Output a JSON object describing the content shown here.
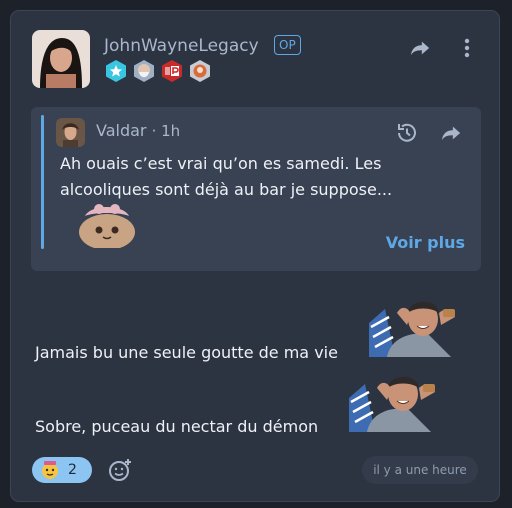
{
  "post": {
    "author": "JohnWayneLegacy",
    "op_label": "OP",
    "badges": [
      "star-badge",
      "bearded-man-badge",
      "red-p-badge",
      "mascot-badge"
    ],
    "actions": [
      "share-icon",
      "more-options-icon"
    ]
  },
  "quote": {
    "author": "Valdar",
    "time": "· 1h",
    "text": "Ah ouais c’est vrai qu’on es samedi. Les alcooliques sont déjà au bar je suppose...",
    "see_more": "Voir plus",
    "actions": [
      "history-icon",
      "share-icon"
    ]
  },
  "body": {
    "line1": "Jamais bu une seule goutte de ma vie",
    "line2": "Sobre, puceau du nectar du démon"
  },
  "footer": {
    "reaction_count": "2",
    "timestamp": "il y a une heure"
  },
  "colors": {
    "accent": "#5fa8e6",
    "card": "#2c3442",
    "quote": "#394253",
    "reaction": "#8cc5f2"
  }
}
